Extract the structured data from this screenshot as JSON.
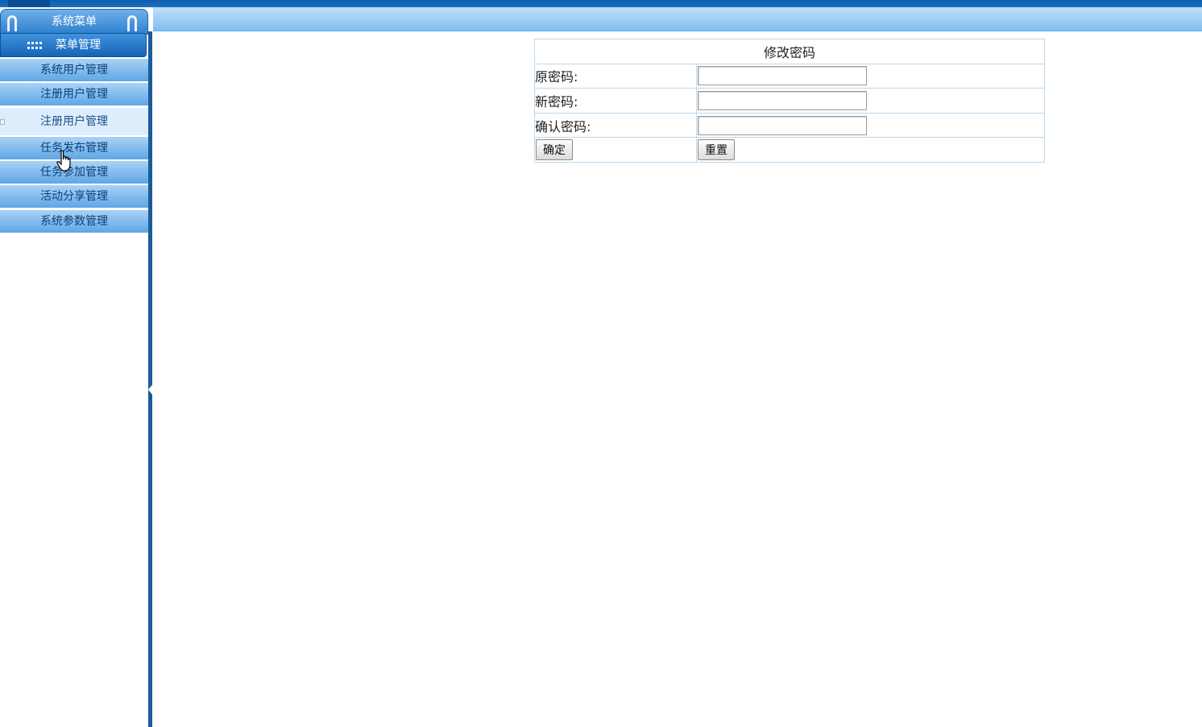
{
  "sidebar": {
    "title": "系统菜单",
    "group_label": "菜单管理",
    "items": [
      {
        "label": "系统用户管理"
      },
      {
        "label": "注册用户管理"
      },
      {
        "label": "注册用户管理"
      },
      {
        "label": "任务发布管理"
      },
      {
        "label": "任务参加管理"
      },
      {
        "label": "活动分享管理"
      },
      {
        "label": "系统参数管理"
      }
    ],
    "active_index": 2
  },
  "form": {
    "title": "修改密码",
    "old_password_label": "原密码:",
    "new_password_label": "新密码:",
    "confirm_password_label": "确认密码:",
    "old_password_value": "",
    "new_password_value": "",
    "confirm_password_value": "",
    "submit_label": "确定",
    "reset_label": "重置"
  },
  "colors": {
    "accent": "#1565b8",
    "menu_item": "#5ea6e6",
    "header_strip": "#7fbef0"
  }
}
